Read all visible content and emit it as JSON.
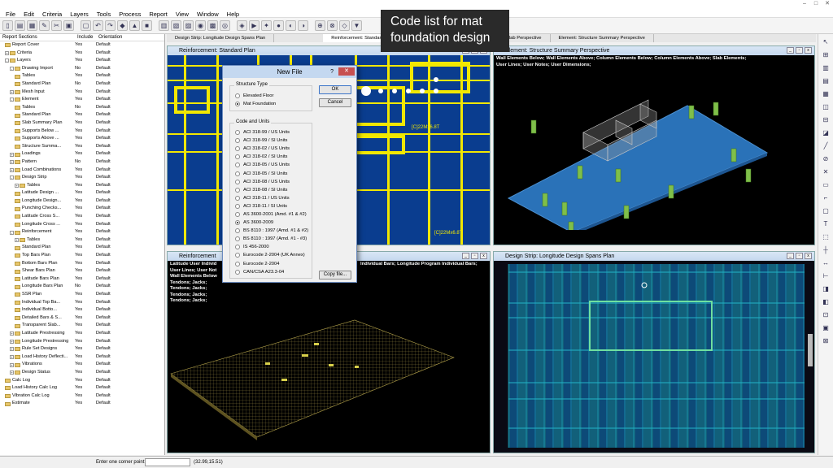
{
  "caption": {
    "line1": "Code list for mat",
    "line2": "foundation design"
  },
  "menu": [
    "File",
    "Edit",
    "Criteria",
    "Layers",
    "Tools",
    "Process",
    "Report",
    "View",
    "Window",
    "Help"
  ],
  "window_controls": [
    "–",
    "□",
    "✕"
  ],
  "report_panel": {
    "headers": [
      "Report Sections",
      "Include",
      "Orientation"
    ],
    "rows": [
      {
        "label": "Report Cover",
        "include": "Yes",
        "orientation": "Default",
        "indent": 1,
        "exp": ""
      },
      {
        "label": "Criteria",
        "include": "Yes",
        "orientation": "Default",
        "indent": 1,
        "exp": "+"
      },
      {
        "label": "Layers",
        "include": "Yes",
        "orientation": "Default",
        "indent": 1,
        "exp": "-"
      },
      {
        "label": "Drawing Import",
        "include": "No",
        "orientation": "Default",
        "indent": 2,
        "exp": "-"
      },
      {
        "label": "Tables",
        "include": "Yes",
        "orientation": "Default",
        "indent": 3,
        "exp": ""
      },
      {
        "label": "Standard Plan",
        "include": "No",
        "orientation": "Default",
        "indent": 3,
        "exp": ""
      },
      {
        "label": "Mesh Input",
        "include": "Yes",
        "orientation": "Default",
        "indent": 2,
        "exp": "+"
      },
      {
        "label": "Element",
        "include": "Yes",
        "orientation": "Default",
        "indent": 2,
        "exp": "-"
      },
      {
        "label": "Tables",
        "include": "No",
        "orientation": "Default",
        "indent": 3,
        "exp": ""
      },
      {
        "label": "Standard Plan",
        "include": "Yes",
        "orientation": "Default",
        "indent": 3,
        "exp": ""
      },
      {
        "label": "Slab Summary Plan",
        "include": "Yes",
        "orientation": "Default",
        "indent": 3,
        "exp": ""
      },
      {
        "label": "Supports Below ...",
        "include": "Yes",
        "orientation": "Default",
        "indent": 3,
        "exp": ""
      },
      {
        "label": "Supports Above ...",
        "include": "Yes",
        "orientation": "Default",
        "indent": 3,
        "exp": ""
      },
      {
        "label": "Structure Summa...",
        "include": "Yes",
        "orientation": "Default",
        "indent": 3,
        "exp": ""
      },
      {
        "label": "Loadings",
        "include": "Yes",
        "orientation": "Default",
        "indent": 2,
        "exp": "+"
      },
      {
        "label": "Pattern",
        "include": "No",
        "orientation": "Default",
        "indent": 2,
        "exp": "+"
      },
      {
        "label": "Load Combinations",
        "include": "Yes",
        "orientation": "Default",
        "indent": 2,
        "exp": "+"
      },
      {
        "label": "Design Strip",
        "include": "Yes",
        "orientation": "Default",
        "indent": 2,
        "exp": "-"
      },
      {
        "label": "Tables",
        "include": "Yes",
        "orientation": "Default",
        "indent": 3,
        "exp": "+"
      },
      {
        "label": "Latitude Design ...",
        "include": "Yes",
        "orientation": "Default",
        "indent": 3,
        "exp": ""
      },
      {
        "label": "Longitude Design...",
        "include": "Yes",
        "orientation": "Default",
        "indent": 3,
        "exp": ""
      },
      {
        "label": "Punching Checks...",
        "include": "Yes",
        "orientation": "Default",
        "indent": 3,
        "exp": ""
      },
      {
        "label": "Latitude Cross S...",
        "include": "Yes",
        "orientation": "Default",
        "indent": 3,
        "exp": ""
      },
      {
        "label": "Longitude Cross ...",
        "include": "Yes",
        "orientation": "Default",
        "indent": 3,
        "exp": ""
      },
      {
        "label": "Reinforcement",
        "include": "Yes",
        "orientation": "Default",
        "indent": 2,
        "exp": "-"
      },
      {
        "label": "Tables",
        "include": "Yes",
        "orientation": "Default",
        "indent": 3,
        "exp": "+"
      },
      {
        "label": "Standard Plan",
        "include": "Yes",
        "orientation": "Default",
        "indent": 3,
        "exp": ""
      },
      {
        "label": "Top Bars Plan",
        "include": "Yes",
        "orientation": "Default",
        "indent": 3,
        "exp": ""
      },
      {
        "label": "Bottom Bars Plan",
        "include": "Yes",
        "orientation": "Default",
        "indent": 3,
        "exp": ""
      },
      {
        "label": "Shear Bars Plan",
        "include": "Yes",
        "orientation": "Default",
        "indent": 3,
        "exp": ""
      },
      {
        "label": "Latitude Bars Plan",
        "include": "Yes",
        "orientation": "Default",
        "indent": 3,
        "exp": ""
      },
      {
        "label": "Longitude Bars Plan",
        "include": "No",
        "orientation": "Default",
        "indent": 3,
        "exp": ""
      },
      {
        "label": "SSR Plan",
        "include": "Yes",
        "orientation": "Default",
        "indent": 3,
        "exp": ""
      },
      {
        "label": "Individual Top Ba...",
        "include": "Yes",
        "orientation": "Default",
        "indent": 3,
        "exp": ""
      },
      {
        "label": "Individual Botto...",
        "include": "Yes",
        "orientation": "Default",
        "indent": 3,
        "exp": ""
      },
      {
        "label": "Detailed Bars & S...",
        "include": "Yes",
        "orientation": "Default",
        "indent": 3,
        "exp": ""
      },
      {
        "label": "Transparent Slab...",
        "include": "Yes",
        "orientation": "Default",
        "indent": 3,
        "exp": ""
      },
      {
        "label": "Latitude Prestressing",
        "include": "Yes",
        "orientation": "Default",
        "indent": 2,
        "exp": "+"
      },
      {
        "label": "Longitude Prestressing",
        "include": "Yes",
        "orientation": "Default",
        "indent": 2,
        "exp": "+"
      },
      {
        "label": "Rule Set Designs",
        "include": "Yes",
        "orientation": "Default",
        "indent": 2,
        "exp": "+"
      },
      {
        "label": "Load History Deflecti...",
        "include": "Yes",
        "orientation": "Default",
        "indent": 2,
        "exp": "+"
      },
      {
        "label": "Vibrations",
        "include": "Yes",
        "orientation": "Default",
        "indent": 2,
        "exp": "+"
      },
      {
        "label": "Design Status",
        "include": "Yes",
        "orientation": "Default",
        "indent": 2,
        "exp": "+"
      },
      {
        "label": "Calc Log",
        "include": "Yes",
        "orientation": "Default",
        "indent": 1,
        "exp": ""
      },
      {
        "label": "Load History Calc Log",
        "include": "Yes",
        "orientation": "Default",
        "indent": 1,
        "exp": ""
      },
      {
        "label": "Vibration Calc Log",
        "include": "Yes",
        "orientation": "Default",
        "indent": 1,
        "exp": ""
      },
      {
        "label": "Estimate",
        "include": "Yes",
        "orientation": "Default",
        "indent": 1,
        "exp": ""
      }
    ]
  },
  "tabs": [
    "Design Strip: Longitude Design Spans Plan",
    "Reinforcement: Standard Plan",
    "lab Perspective",
    "Element: Structure Summary Perspective"
  ],
  "views": {
    "top_left": {
      "title": "Reinforcement: Standard Plan"
    },
    "top_right": {
      "title": "Element: Structure Summary Perspective",
      "info": [
        "Wall Elements Below; Wall Elements Above; Column Elements Below; Column Elements Above; Slab Elements;",
        "User Lines; User Notes; User Dimensions;"
      ]
    },
    "bottom_left": {
      "title": "Reinforcement",
      "info": [
        "Latitude User Individ",
        "User Lines; User Not",
        "Wall Elements Below",
        "Tendons; Jacks;",
        "Tendons; Jacks;",
        "Tendons; Jacks;",
        "Tendons; Jacks;"
      ],
      "info_right": "Individual Bars; Longitude Program Individual Bars;"
    },
    "bottom_right": {
      "title": "Design Strip: Longitude Design Spans Plan"
    }
  },
  "dialog": {
    "title": "New File",
    "help": "?",
    "close": "✕",
    "structure_type_label": "Structure Type",
    "structure_types": [
      {
        "label": "Elevated Floor",
        "selected": false
      },
      {
        "label": "Mat Foundation",
        "selected": true
      }
    ],
    "code_units_label": "Code and Units",
    "codes": [
      {
        "label": "ACI 318-99 / US Units",
        "selected": false
      },
      {
        "label": "ACI 318-99 / SI Units",
        "selected": false
      },
      {
        "label": "ACI 318-02 / US Units",
        "selected": false
      },
      {
        "label": "ACI 318-02 / SI Units",
        "selected": false
      },
      {
        "label": "ACI 318-05 / US Units",
        "selected": false
      },
      {
        "label": "ACI 318-05 / SI Units",
        "selected": false
      },
      {
        "label": "ACI 318-08 / US Units",
        "selected": false
      },
      {
        "label": "ACI 318-08 / SI Units",
        "selected": false
      },
      {
        "label": "ACI 318-11 / US Units",
        "selected": false
      },
      {
        "label": "ACI 318-11 / SI Units",
        "selected": false
      },
      {
        "label": "AS 3600-2001 (Amd. #1 & #2)",
        "selected": false
      },
      {
        "label": "AS 3600-2009",
        "selected": true
      },
      {
        "label": "BS 8110 : 1997 (Amd. #1 & #2)",
        "selected": false
      },
      {
        "label": "BS 8110 : 1997 (Amd. #1 - #3)",
        "selected": false
      },
      {
        "label": "IS 456-2000",
        "selected": false
      },
      {
        "label": "Eurocode 2-2004 (UK Annex)",
        "selected": false
      },
      {
        "label": "Eurocode 2-2004",
        "selected": false
      },
      {
        "label": "CAN/CSA A23.3-04",
        "selected": false
      }
    ],
    "ok": "OK",
    "cancel": "Cancel",
    "copy_file": "Copy file..."
  },
  "plan_labels": [
    "[C]22Mx6.8T",
    "[C]22Mx6.8T"
  ],
  "status": {
    "prompt": "Enter one corner point:",
    "input": "",
    "coords": "(32.99,15.51)"
  },
  "colors": {
    "yellow": "#f2e800",
    "blue_plan": "#0a3d8f",
    "slab_blue": "#2a72b8",
    "cyan_grid": "#22b4c8",
    "green_col": "#7fbf4a"
  }
}
